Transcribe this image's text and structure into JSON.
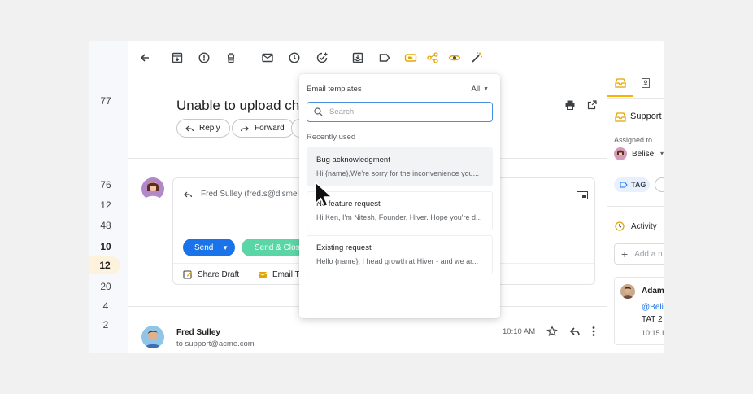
{
  "rail": {
    "numbers": [
      "77",
      "76",
      "12",
      "48",
      "10",
      "12",
      "20",
      "4",
      "2"
    ]
  },
  "toolbar": {
    "icons": [
      "back-arrow-icon",
      "archive-icon",
      "report-spam-icon",
      "delete-icon",
      "mail-icon",
      "snooze-icon",
      "add-task-icon",
      "move-to-icon",
      "label-icon",
      "tag-icon",
      "share-icon",
      "eye-icon",
      "magic-wand-icon"
    ]
  },
  "email": {
    "subject": "Unable to upload char",
    "reply_label": "Reply",
    "forward_label": "Forward",
    "compose_to": "Fred Sulley (fred.s@dismelt",
    "send_label": "Send",
    "send_close_label": "Send & Close",
    "share_draft_label": "Share Draft",
    "email_templates_label": "Email Te",
    "sender_name": "Fred Sulley",
    "sender_to": "to support@acme.com",
    "time": "10:10 AM"
  },
  "right_panel": {
    "support_label": "Support",
    "assigned_to_label": "Assigned to",
    "assignee": "Belise",
    "tag_label": "TAG",
    "activity_label": "Activity",
    "add_placeholder": "Add a n",
    "comment_author": "Adam",
    "comment_mention": "@Belis",
    "comment_text": "TAT 2",
    "comment_time": "10:15 I"
  },
  "templates_dropdown": {
    "title": "Email templates",
    "filter": "All",
    "search_placeholder": "Search",
    "section": "Recently used",
    "items": [
      {
        "name": "Bug acknowledgment",
        "preview": "Hi {name},We're sorry for the inconvenience you..."
      },
      {
        "name": "Ne  feature request",
        "preview": "Hi Ken, I'm Nitesh, Founder, Hiver. Hope you're d..."
      },
      {
        "name": "Existing request",
        "preview": "Hello {name}, I head growth at Hiver - and we ar..."
      }
    ]
  },
  "colors": {
    "primary": "#1a73e8",
    "send_close": "#5ad6a6",
    "accent": "#f5b400",
    "highlight": "#fdf3dc"
  }
}
